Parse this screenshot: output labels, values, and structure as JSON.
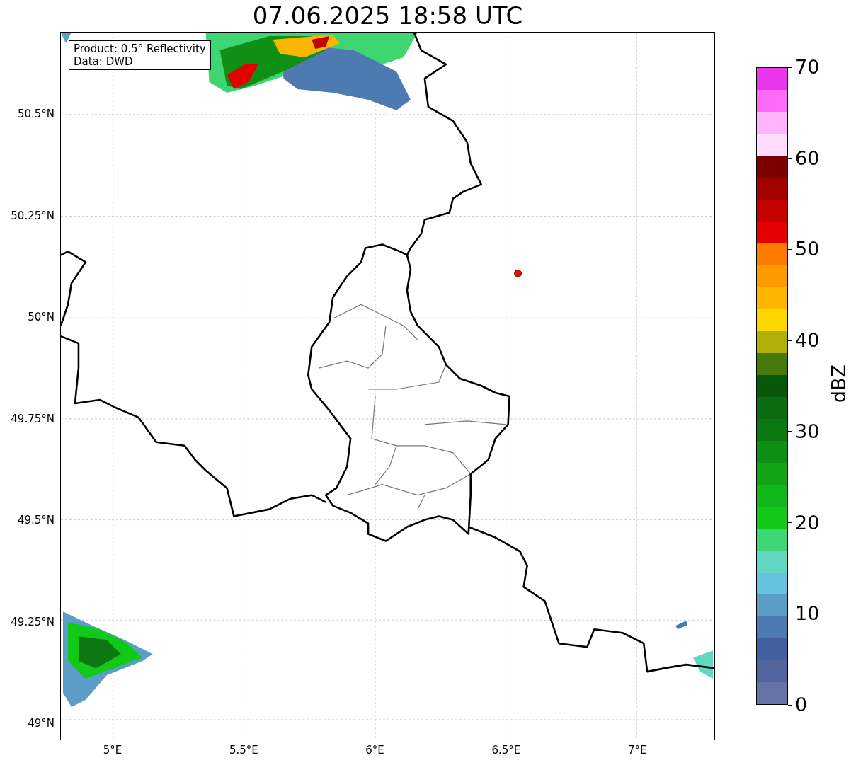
{
  "title": "07.06.2025 18:58 UTC",
  "info_box": [
    "Product: 0.5° Reflectivity",
    "Data: DWD"
  ],
  "y_ticks": [
    "50.5°N",
    "50.25°N",
    "50°N",
    "49.75°N",
    "49.5°N",
    "49.25°N",
    "49°N"
  ],
  "x_ticks": [
    "5°E",
    "5.5°E",
    "6°E",
    "6.5°E",
    "7°E"
  ],
  "colorbar": {
    "label": "dBZ",
    "ticks": [
      "70",
      "60",
      "50",
      "40",
      "30",
      "20",
      "10",
      "0"
    ]
  }
}
